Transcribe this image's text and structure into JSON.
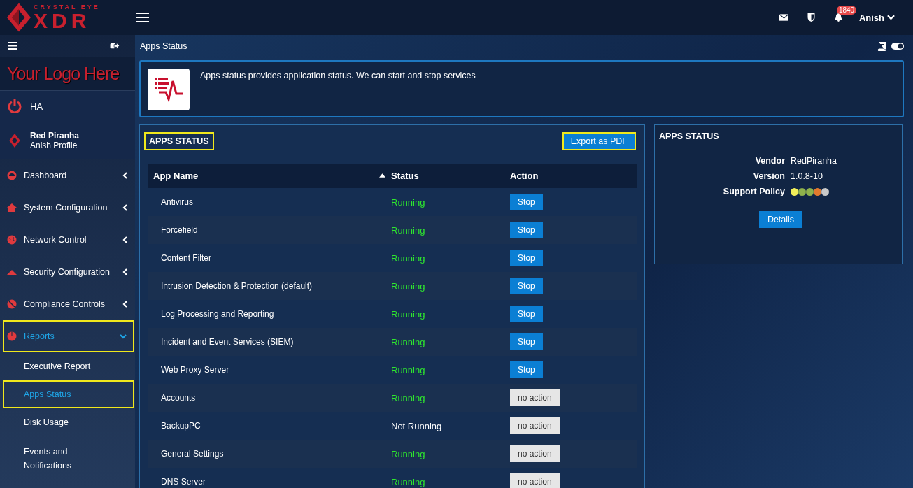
{
  "brand": {
    "tagline": "CRYSTAL EYE",
    "name": "XDR"
  },
  "topbar": {
    "notification_count": "1840",
    "user": "Anish"
  },
  "sidebar": {
    "custom_logo": "Your Logo Here",
    "ha": "HA",
    "profile": {
      "company": "Red Piranha",
      "name": "Anish Profile"
    },
    "items": [
      {
        "label": "Dashboard",
        "expanded": false,
        "selected": false,
        "highlighted": false
      },
      {
        "label": "System Configuration",
        "expanded": false,
        "selected": false,
        "highlighted": false
      },
      {
        "label": "Network Control",
        "expanded": false,
        "selected": false,
        "highlighted": false
      },
      {
        "label": "Security Configuration",
        "expanded": false,
        "selected": false,
        "highlighted": false
      },
      {
        "label": "Compliance Controls",
        "expanded": false,
        "selected": false,
        "highlighted": false
      },
      {
        "label": "Reports",
        "expanded": true,
        "selected": true,
        "highlighted": true,
        "children": [
          {
            "label": "Executive Report",
            "selected": false,
            "highlighted": false
          },
          {
            "label": "Apps Status",
            "selected": true,
            "highlighted": true
          },
          {
            "label": "Disk Usage",
            "selected": false,
            "highlighted": false
          },
          {
            "label": "Events and Notifications",
            "selected": false,
            "highlighted": false
          }
        ]
      }
    ]
  },
  "breadcrumb": "Apps Status",
  "info": "Apps status provides application status. We can start and stop services",
  "apps_panel": {
    "title": "APPS STATUS",
    "title_highlighted": true,
    "export_button": "Export as PDF",
    "export_highlighted": true,
    "table": {
      "columns": [
        "App Name",
        "Status",
        "Action"
      ],
      "rows": [
        {
          "name": "Antivirus",
          "status": "Running",
          "running": true,
          "action": "Stop",
          "kind": "stop"
        },
        {
          "name": "Forcefield",
          "status": "Running",
          "running": true,
          "action": "Stop",
          "kind": "stop"
        },
        {
          "name": "Content Filter",
          "status": "Running",
          "running": true,
          "action": "Stop",
          "kind": "stop"
        },
        {
          "name": "Intrusion Detection & Protection (default)",
          "status": "Running",
          "running": true,
          "action": "Stop",
          "kind": "stop"
        },
        {
          "name": "Log Processing and Reporting",
          "status": "Running",
          "running": true,
          "action": "Stop",
          "kind": "stop"
        },
        {
          "name": "Incident and Event Services (SIEM)",
          "status": "Running",
          "running": true,
          "action": "Stop",
          "kind": "stop"
        },
        {
          "name": "Web Proxy Server",
          "status": "Running",
          "running": true,
          "action": "Stop",
          "kind": "stop"
        },
        {
          "name": "Accounts",
          "status": "Running",
          "running": true,
          "action": "no action",
          "kind": "none"
        },
        {
          "name": "BackupPC",
          "status": "Not Running",
          "running": false,
          "action": "no action",
          "kind": "none"
        },
        {
          "name": "General Settings",
          "status": "Running",
          "running": true,
          "action": "no action",
          "kind": "none"
        },
        {
          "name": "DNS Server",
          "status": "Running",
          "running": true,
          "action": "no action",
          "kind": "none"
        }
      ]
    }
  },
  "details_panel": {
    "title": "APPS STATUS",
    "fields": [
      {
        "label": "Vendor",
        "value": "RedPiranha"
      },
      {
        "label": "Version",
        "value": "1.0.8-10"
      }
    ],
    "support_label": "Support Policy",
    "support_dots": [
      {
        "color": "#f2ee5a"
      },
      {
        "color": "#8fb24c"
      },
      {
        "color": "#8fb24c"
      },
      {
        "color": "#e27a2e"
      },
      {
        "color": "#c9c9c9"
      }
    ],
    "button": "Details"
  }
}
